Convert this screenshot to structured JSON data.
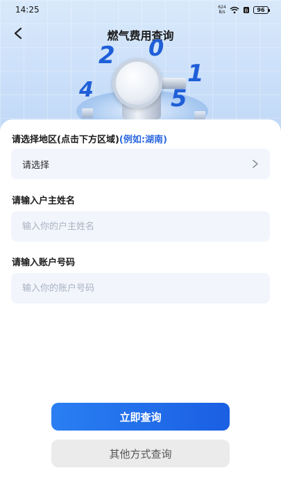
{
  "status_bar": {
    "time": "14:25",
    "net_speed_top": "624",
    "net_speed_bottom": "B/s",
    "battery": "96"
  },
  "header": {
    "title": "燃气费用查询",
    "deco_digits": [
      "2",
      "0",
      "1",
      "4",
      "5"
    ]
  },
  "form": {
    "region": {
      "label": "请选择地区(点击下方区域)",
      "hint": "(例如:湖南)",
      "value": "请选择"
    },
    "owner_name": {
      "label": "请输入户主姓名",
      "placeholder": "输入你的户主姓名",
      "value": ""
    },
    "account_number": {
      "label": "请输入账户号码",
      "placeholder": "输入你的账户号码",
      "value": ""
    }
  },
  "actions": {
    "primary": "立即查询",
    "secondary": "其他方式查询"
  },
  "colors": {
    "accent": "#1a5fe3",
    "hint": "#2a66e0",
    "field_bg": "#f2f5fc"
  },
  "icons": {
    "back": "chevron-left-icon",
    "select_arrow": "chevron-right-icon",
    "wifi": "wifi-icon",
    "signal": "signal-icon",
    "battery": "battery-icon"
  }
}
